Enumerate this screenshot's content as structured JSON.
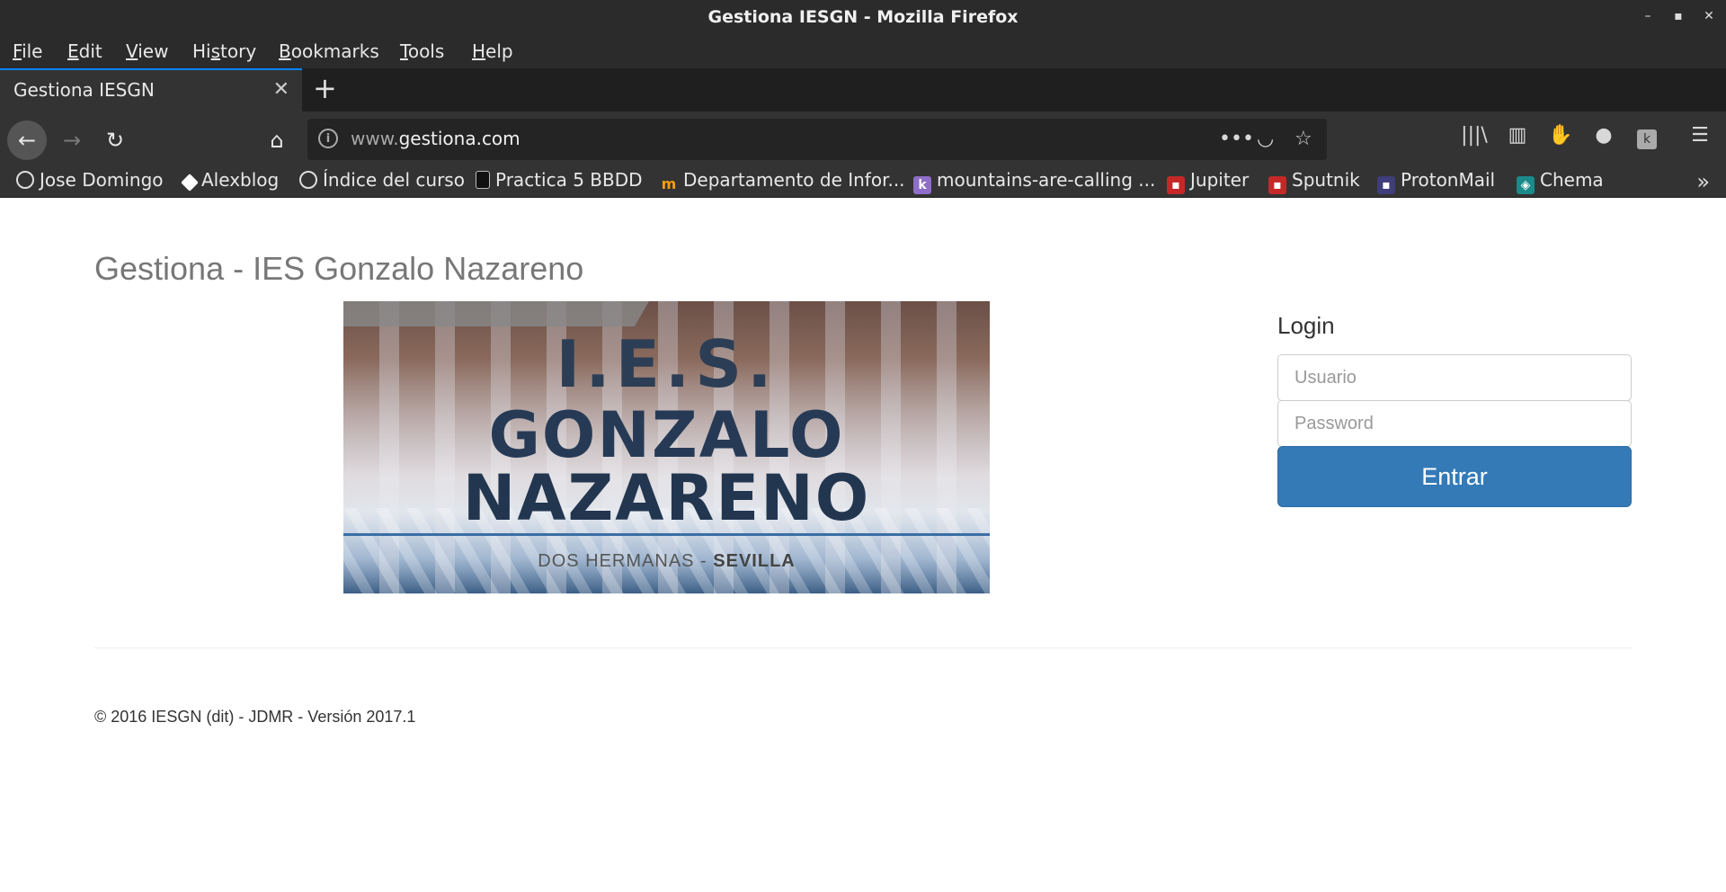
{
  "window": {
    "title": "Gestiona IESGN - Mozilla Firefox",
    "controls": [
      "–",
      "▪",
      "✕"
    ]
  },
  "menu": [
    {
      "label": "File",
      "accel": "F",
      "rest": "ile"
    },
    {
      "label": "Edit",
      "accel": "E",
      "rest": "dit"
    },
    {
      "label": "View",
      "accel": "V",
      "rest": "iew"
    },
    {
      "label": "History",
      "accel": "s",
      "pre": "Hi",
      "rest": "tory"
    },
    {
      "label": "Bookmarks",
      "accel": "B",
      "rest": "ookmarks"
    },
    {
      "label": "Tools",
      "accel": "T",
      "rest": "ools"
    },
    {
      "label": "Help",
      "accel": "H",
      "rest": "elp"
    }
  ],
  "tab": {
    "title": "Gestiona IESGN",
    "close": "✕"
  },
  "newtab": "+",
  "nav": {
    "back": "←",
    "forward": "→",
    "reload": "↻",
    "home": "⌂",
    "url_prefix": "www.",
    "url_host": "gestiona.com",
    "page_actions": "•••",
    "pocket": "◡",
    "star": "☆",
    "library": "|||\\",
    "sidebar": "▥",
    "ublock": "✋",
    "account": "●",
    "ext": "k",
    "menu": "☰"
  },
  "bookmarks": [
    {
      "label": "Jose Domingo",
      "icon": "globe-icon"
    },
    {
      "label": "Alexblog",
      "icon": "alexblog-icon"
    },
    {
      "label": "Índice del curso",
      "icon": "globe-icon"
    },
    {
      "label": "Practica 5 BBDD",
      "icon": "document-icon"
    },
    {
      "label": "Departamento de Infor...",
      "icon": "moodle-icon"
    },
    {
      "label": "mountains-are-calling ...",
      "icon": "k-icon"
    },
    {
      "label": "Jupiter",
      "icon": "red-square-icon"
    },
    {
      "label": "Sputnik",
      "icon": "red-square-icon"
    },
    {
      "label": "ProtonMail",
      "icon": "protonmail-icon"
    },
    {
      "label": "Chema",
      "icon": "chema-icon"
    }
  ],
  "bookmarks_overflow": "»",
  "page": {
    "heading": "Gestiona - IES Gonzalo Nazareno",
    "banner": {
      "line1": "I.E.S.",
      "line2": "GONZALO",
      "line3": "NAZARENO",
      "sub_left": "DOS HERMANAS - ",
      "sub_right": "SEVILLA"
    },
    "login": {
      "title": "Login",
      "user_placeholder": "Usuario",
      "password_placeholder": "Password",
      "submit": "Entrar"
    },
    "footer": "© 2016 IESGN (dit) - JDMR - Versión 2017.1"
  }
}
